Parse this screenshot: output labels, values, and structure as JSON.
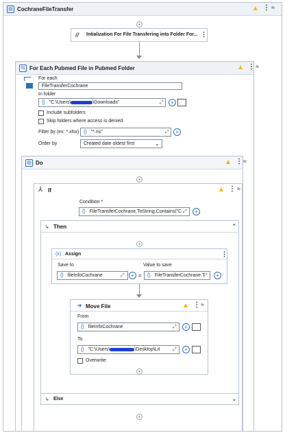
{
  "workflow": {
    "title": "CochraneFileTransfer"
  },
  "init_activity": {
    "title": "Intialization For File Transfering into Folder For..."
  },
  "foreach": {
    "title": "For Each Pubmed File in Pubmed Folder",
    "for_each_label": "For each",
    "item_value": "FileTransferCochrane",
    "in_folder_label": "In folder",
    "in_folder_pre": "\"C:\\Users\\",
    "in_folder_post": "\\Downloads\"",
    "include_subfolders": "Include subfolders",
    "skip_folders": "Skip folders where access is denied",
    "filter_label": "Filter by (ex: *.xlsx)",
    "filter_value": "\"*.ris\"",
    "order_label": "Order by",
    "order_value": "Created date oldest first"
  },
  "do": {
    "title": "Do"
  },
  "if": {
    "title": "If",
    "condition_label": "Condition *",
    "condition_value": "FileTransferCochrane.ToString.Contains(\"C",
    "then_label": "Then",
    "else_label": "Else"
  },
  "assign": {
    "title": "Assign",
    "prefix": "(x)",
    "save_to_label": "Save to",
    "save_to_value": "fileInfoCochrane",
    "value_label": "Value to save",
    "value_value": "FileTransferCochrane.T",
    "equals": "="
  },
  "move": {
    "title": "Move File",
    "from_label": "From",
    "from_value": "fileInfoCochrane",
    "to_label": "To",
    "to_pre": "\"C:\\Users\\",
    "to_post": "\\Desktop\\Lit",
    "overwrite_label": "Overwrite"
  },
  "icons": {
    "brace": "{}",
    "plus": "+",
    "dots": "⋮",
    "collapse": "≈",
    "warn": "▲",
    "chevron_up": "⌃",
    "chevron_down": "⌄"
  },
  "colors": {
    "accent": "#2f6fbe",
    "warning": "#f2b600",
    "redaction": "#1e3fd6"
  }
}
